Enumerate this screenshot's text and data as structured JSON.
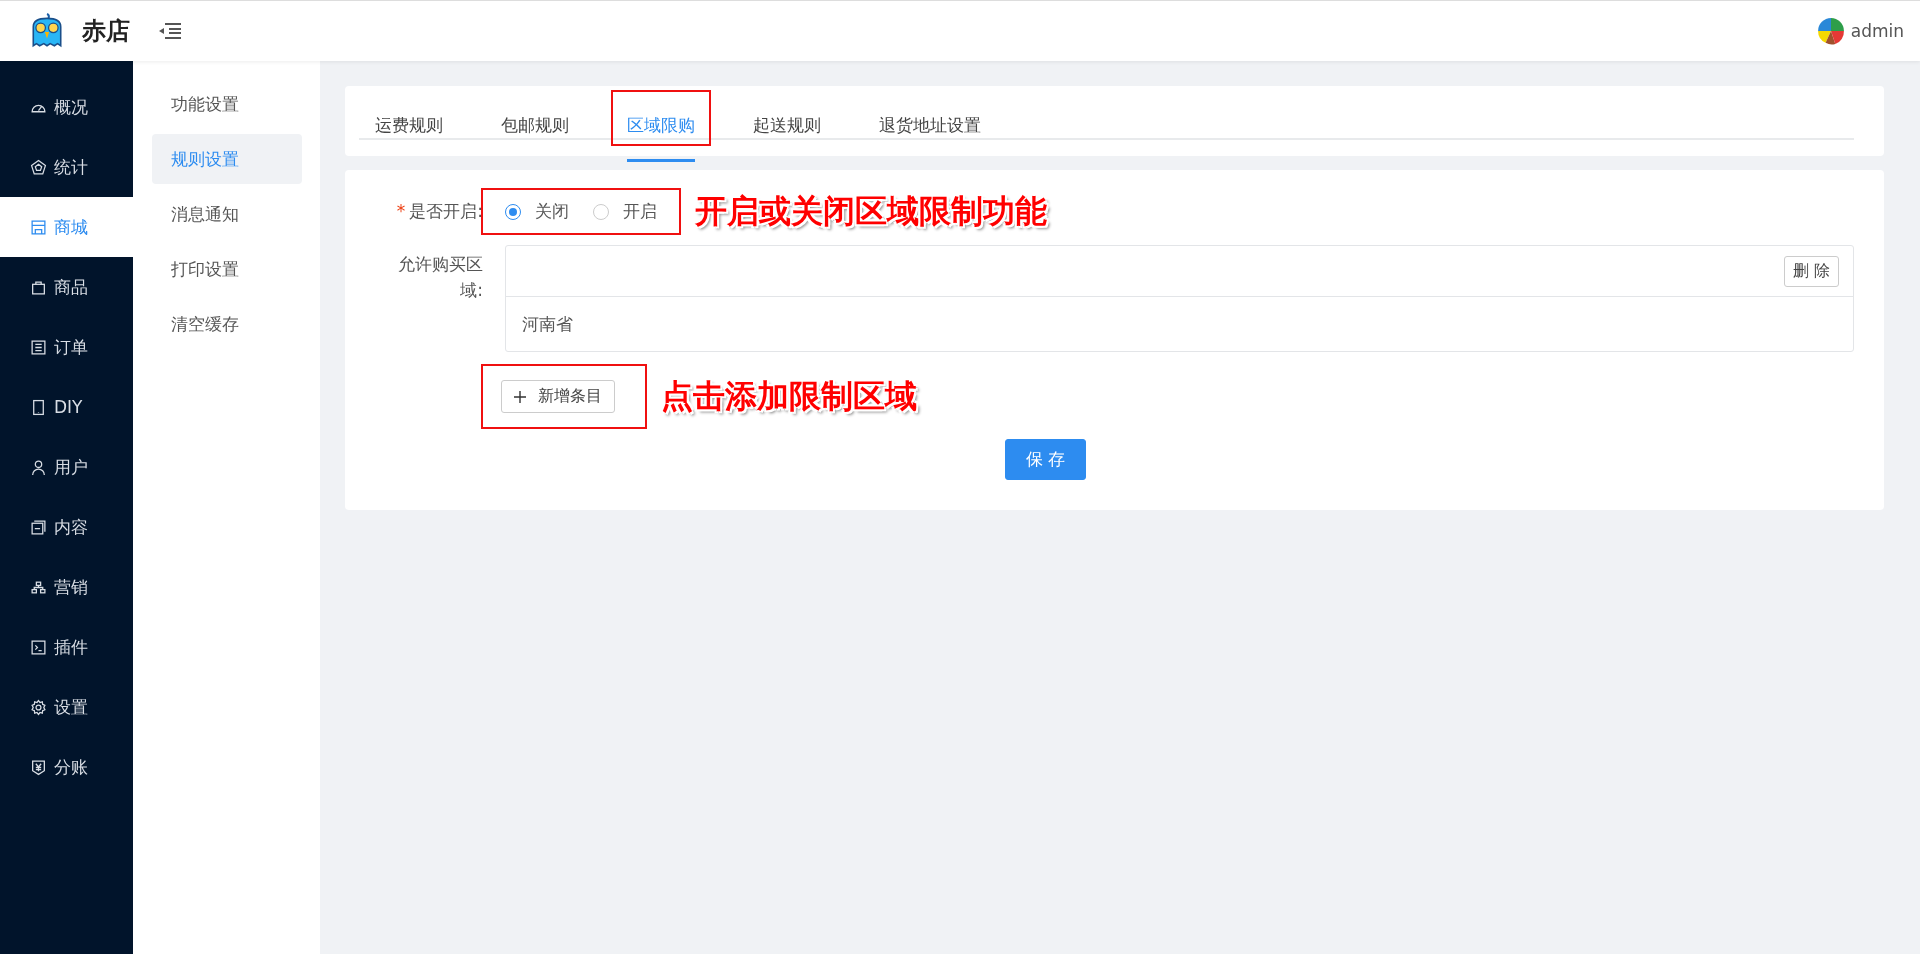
{
  "header": {
    "brand": "赤店",
    "user": "admin"
  },
  "nav": [
    {
      "label": "概况",
      "selected": false
    },
    {
      "label": "统计",
      "selected": false
    },
    {
      "label": "商城",
      "selected": true
    },
    {
      "label": "商品",
      "selected": false
    },
    {
      "label": "订单",
      "selected": false
    },
    {
      "label": "DIY",
      "selected": false
    },
    {
      "label": "用户",
      "selected": false
    },
    {
      "label": "内容",
      "selected": false
    },
    {
      "label": "营销",
      "selected": false
    },
    {
      "label": "插件",
      "selected": false
    },
    {
      "label": "设置",
      "selected": false
    },
    {
      "label": "分账",
      "selected": false
    }
  ],
  "subnav": [
    {
      "label": "功能设置",
      "selected": false
    },
    {
      "label": "规则设置",
      "selected": true
    },
    {
      "label": "消息通知",
      "selected": false
    },
    {
      "label": "打印设置",
      "selected": false
    },
    {
      "label": "清空缓存",
      "selected": false
    }
  ],
  "tabs": [
    {
      "label": "运费规则",
      "selected": false,
      "highlighted": false
    },
    {
      "label": "包邮规则",
      "selected": false,
      "highlighted": false
    },
    {
      "label": "区域限购",
      "selected": true,
      "highlighted": true
    },
    {
      "label": "起送规则",
      "selected": false,
      "highlighted": false
    },
    {
      "label": "退货地址设置",
      "selected": false,
      "highlighted": false
    }
  ],
  "form": {
    "enable": {
      "label": "是否开启:",
      "required_mark": "*",
      "highlighted": true,
      "annotation": "开启或关闭区域限制功能",
      "options": [
        {
          "label": "关闭",
          "selected": true
        },
        {
          "label": "开启",
          "selected": false
        }
      ]
    },
    "regions": {
      "label": "允许购买区域:",
      "delete_button": "删 除",
      "rows": [
        "河南省"
      ]
    },
    "add_button": {
      "label": "新增条目",
      "highlighted": true,
      "annotation": "点击添加限制区域"
    },
    "save_button": "保 存"
  }
}
